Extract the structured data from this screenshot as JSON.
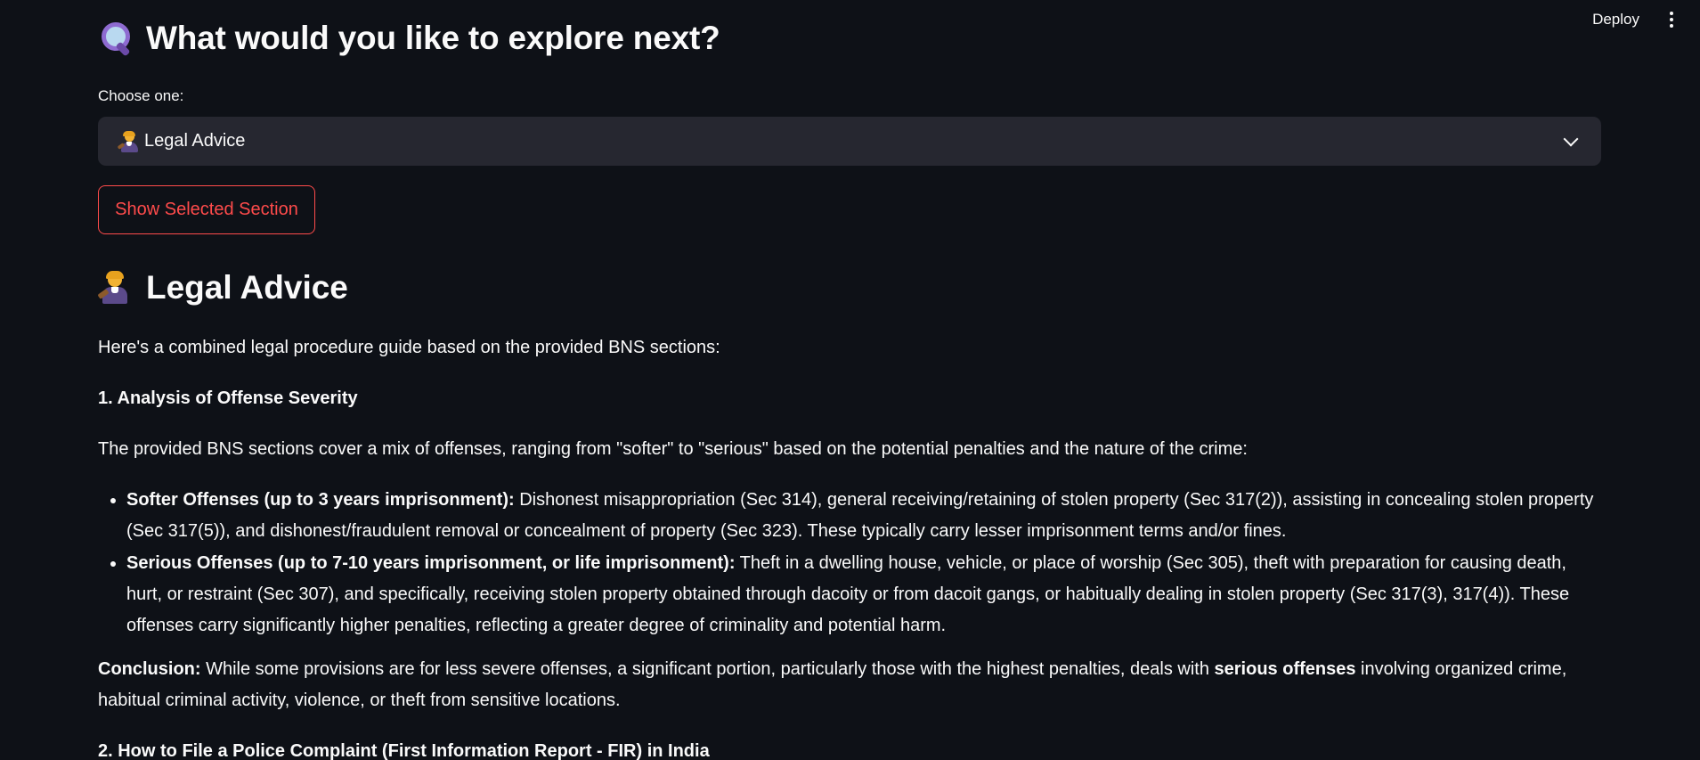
{
  "header": {
    "deploy_label": "Deploy"
  },
  "explore": {
    "title": "What would you like to explore next?",
    "select_label": "Choose one:",
    "selected_value": "Legal Advice",
    "show_button": "Show Selected Section"
  },
  "section": {
    "title": "Legal Advice",
    "intro": "Here's a combined legal procedure guide based on the provided BNS sections:",
    "heading1": "1. Analysis of Offense Severity",
    "para1": "The provided BNS sections cover a mix of offenses, ranging from \"softer\" to \"serious\" based on the potential penalties and the nature of the crime:",
    "bullets": [
      {
        "lead": "Softer Offenses (up to 3 years imprisonment):",
        "text": " Dishonest misappropriation (Sec 314), general receiving/retaining of stolen property (Sec 317(2)), assisting in concealing stolen property (Sec 317(5)), and dishonest/fraudulent removal or concealment of property (Sec 323). These typically carry lesser imprisonment terms and/or fines."
      },
      {
        "lead": "Serious Offenses (up to 7-10 years imprisonment, or life imprisonment):",
        "text": " Theft in a dwelling house, vehicle, or place of worship (Sec 305), theft with preparation for causing death, hurt, or restraint (Sec 307), and specifically, receiving stolen property obtained through dacoity or from dacoit gangs, or habitually dealing in stolen property (Sec 317(3), 317(4)). These offenses carry significantly higher penalties, reflecting a greater degree of criminality and potential harm."
      }
    ],
    "conclusion_lead": "Conclusion:",
    "conclusion_text1": " While some provisions are for less severe offenses, a significant portion, particularly those with the highest penalties, deals with ",
    "conclusion_bold": "serious offenses",
    "conclusion_text2": " involving organized crime, habitual criminal activity, violence, or theft from sensitive locations.",
    "heading2": "2. How to File a Police Complaint (First Information Report - FIR) in India"
  },
  "colors": {
    "background": "#0e1117",
    "select_bg": "#262730",
    "accent": "#ff4b4b"
  },
  "icons": {
    "title_icon": "magnifying-glass-icon",
    "section_icon": "judge-icon"
  }
}
